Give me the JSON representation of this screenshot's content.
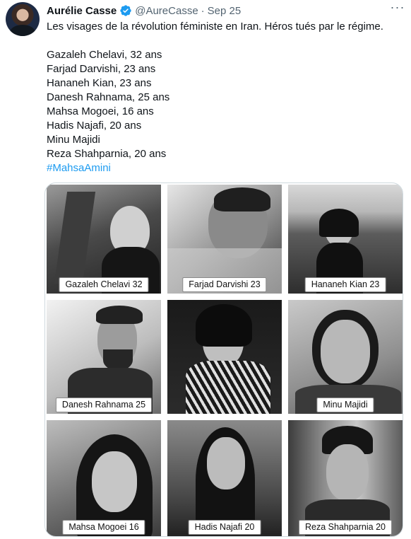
{
  "tweet": {
    "display_name": "Aurélie Casse",
    "handle": "@AureCasse",
    "separator": "·",
    "date": "Sep 25",
    "more_icon": "more-horizontal-icon",
    "verified_icon": "verified-badge-icon",
    "colors": {
      "verified": "#1d9bf0",
      "hashtag": "#1d9bf0",
      "secondary_text": "#536471"
    },
    "lines": [
      "Les visages de la révolution féministe en Iran. Héros tués par le régime.",
      "Gazaleh Chelavi, 32 ans",
      "Farjad Darvishi, 23 ans",
      "Hananeh Kian, 23 ans",
      "Danesh Rahnama, 25 ans",
      "Mahsa Mogoei, 16 ans",
      "Hadis Najafi, 20 ans",
      "Minu Majidi",
      "Reza Shahparnia, 20 ans"
    ],
    "hashtag": "#MahsaAmini"
  },
  "photos": [
    {
      "caption": "Gazaleh Chelavi 32"
    },
    {
      "caption": "Farjad Darvishi 23"
    },
    {
      "caption": "Hananeh Kian 23"
    },
    {
      "caption": "Danesh Rahnama 25"
    },
    {
      "caption": ""
    },
    {
      "caption": "Minu Majidi"
    },
    {
      "caption": "Mahsa Mogoei 16"
    },
    {
      "caption": "Hadis Najafi 20"
    },
    {
      "caption": "Reza Shahparnia 20"
    }
  ]
}
